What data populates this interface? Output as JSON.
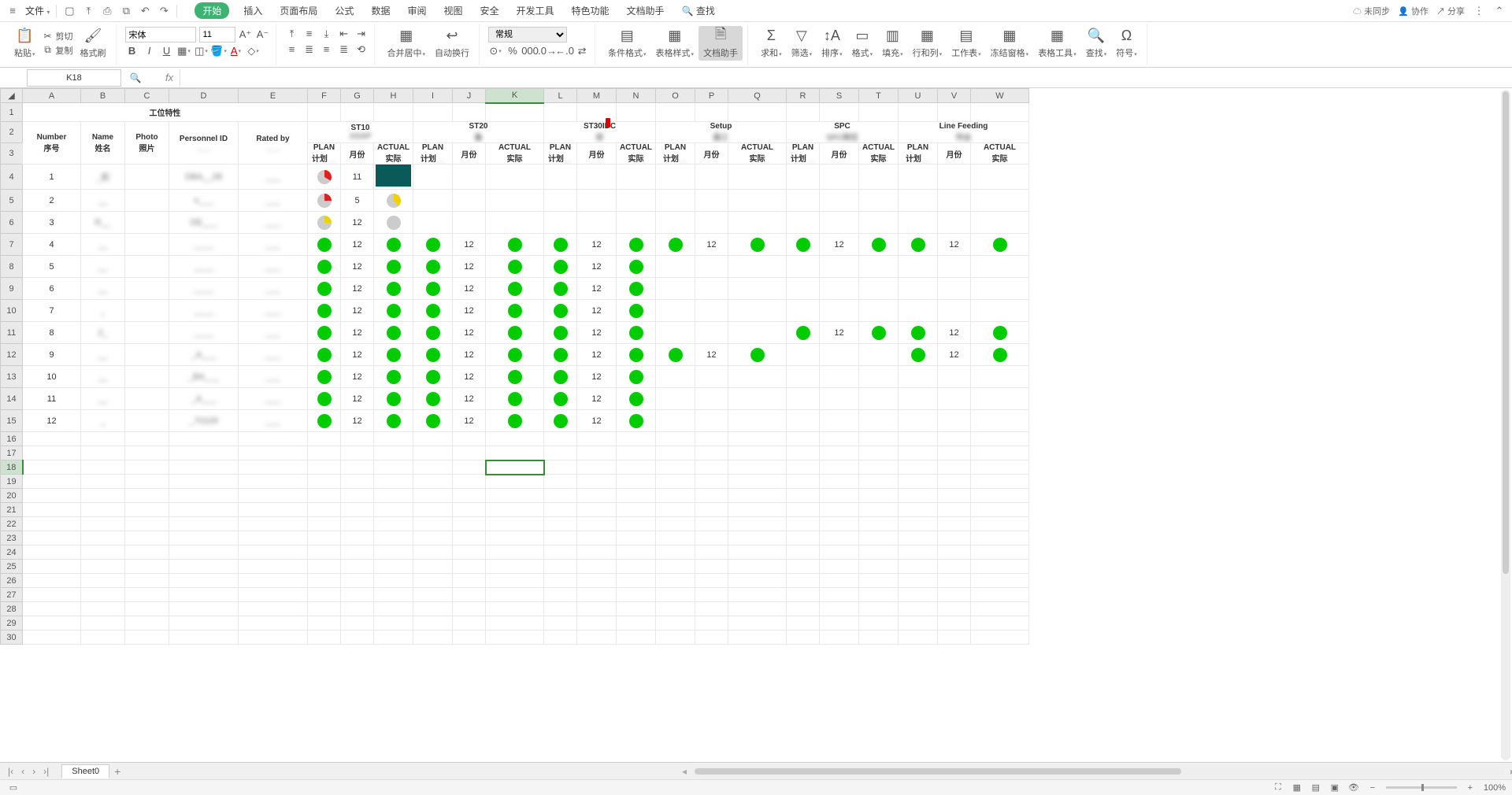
{
  "topbar": {
    "file": "文件",
    "quick": [
      "new",
      "open",
      "print",
      "print-preview",
      "undo",
      "redo"
    ],
    "menus": [
      "开始",
      "插入",
      "页面布局",
      "公式",
      "数据",
      "审阅",
      "视图",
      "安全",
      "开发工具",
      "特色功能",
      "文档助手"
    ],
    "active_menu": 0,
    "find": "查找",
    "right": {
      "sync": "未同步",
      "collab": "协作",
      "share": "分享"
    }
  },
  "ribbon": {
    "paste": "粘贴",
    "cut": "剪切",
    "copy": "复制",
    "format_painter": "格式刷",
    "font_name": "宋体",
    "font_size": "11",
    "merge": "合并居中",
    "wrap": "自动换行",
    "number_format": "常规",
    "cond_fmt": "条件格式",
    "table_style": "表格样式",
    "doc_helper": "文档助手",
    "sum": "求和",
    "filter": "筛选",
    "sort": "排序",
    "format": "格式",
    "fill": "填充",
    "rowcol": "行和列",
    "worksheet": "工作表",
    "freeze": "冻结窗格",
    "table_tools": "表格工具",
    "find_btn": "查找",
    "symbol": "符号"
  },
  "fbar": {
    "cell_ref": "K18",
    "formula": ""
  },
  "columns": [
    "A",
    "B",
    "C",
    "D",
    "E",
    "F",
    "G",
    "H",
    "I",
    "J",
    "K",
    "L",
    "M",
    "N",
    "O",
    "P",
    "Q",
    "R",
    "S",
    "T",
    "U",
    "V",
    "W"
  ],
  "selected_col": "K",
  "selected_row": 18,
  "row_headers": [
    1,
    2,
    3,
    4,
    5,
    6,
    7,
    8,
    9,
    10,
    11,
    12,
    13,
    14,
    15,
    16,
    17,
    18,
    19,
    20,
    21,
    22,
    23,
    24,
    25,
    26,
    27,
    28,
    29,
    30
  ],
  "h1": {
    "title": "工位特性",
    "stations": [
      "ST10",
      "ST20",
      "ST30IDC",
      "Setup",
      "SPC",
      "Line Feeding"
    ],
    "sub": [
      "ASAP",
      "备",
      "安",
      "装工",
      "SPC岗位",
      "作业"
    ]
  },
  "h2": {
    "number": "Number",
    "number2": "序号",
    "name": "Name",
    "name2": "姓名",
    "photo": "Photo",
    "photo2": "照片",
    "pid": "Personnel ID",
    "rated": "Rated by",
    "plan": "PLAN",
    "plan2": "计划",
    "month": "月份",
    "actual": "ACTUAL",
    "actual2": "实际"
  },
  "rows": [
    {
      "n": "1",
      "name": "_莉",
      "pid": "DBA__08",
      "rated": "___",
      "plan1": "pie-red33",
      "m1": "11",
      "a1": "teal"
    },
    {
      "n": "2",
      "name": "__",
      "pid": "n___",
      "rated": "___",
      "plan1": "pie-red25",
      "m1": "5",
      "a1": "pie-yel"
    },
    {
      "n": "3",
      "name": "R__",
      "pid": "DE___",
      "rated": "___",
      "plan1": "pie-yel25",
      "m1": "12",
      "a1": "pie-gry"
    },
    {
      "n": "4",
      "name": "__",
      "pid": "____",
      "rated": "___",
      "plan1": "green",
      "m1": "12",
      "a1": "green",
      "p2": "green",
      "m2": "12",
      "a2": "green",
      "p25": "green",
      "p3": "green",
      "m3": "12",
      "a3": "green",
      "p35": "green",
      "p4": "green",
      "m4": "12",
      "a4": "green",
      "p45": "green",
      "p5": "green",
      "m5": "12",
      "a5": "green",
      "p55": "green",
      "p6": "green",
      "m6": "12",
      "a6": "green"
    },
    {
      "n": "5",
      "name": "__",
      "pid": "____",
      "rated": "___",
      "plan1": "green",
      "m1": "12",
      "a1": "green",
      "p2": "green",
      "m2": "12",
      "a2": "green",
      "p25": "green",
      "p3": "green",
      "m3": "12",
      "a3": "green"
    },
    {
      "n": "6",
      "name": "__",
      "pid": "____",
      "rated": "___",
      "plan1": "green",
      "m1": "12",
      "a1": "green",
      "p2": "green",
      "m2": "12",
      "a2": "green",
      "p25": "green",
      "p3": "green",
      "m3": "12",
      "a3": "green"
    },
    {
      "n": "7",
      "name": "_",
      "pid": "____",
      "rated": "___",
      "plan1": "green",
      "m1": "12",
      "a1": "green",
      "p2": "green",
      "m2": "12",
      "a2": "green",
      "p25": "green",
      "p3": "green",
      "m3": "12",
      "a3": "green"
    },
    {
      "n": "8",
      "name": "2_",
      "pid": "____",
      "rated": "___",
      "plan1": "green",
      "m1": "12",
      "a1": "green",
      "p2": "green",
      "m2": "12",
      "a2": "green",
      "p25": "green",
      "p3": "green",
      "m3": "12",
      "a3": "green",
      "p45": "green",
      "p5": "green",
      "m5": "12",
      "a5": "green",
      "p55": "green",
      "p6": "green",
      "m6": "12",
      "a6": "green"
    },
    {
      "n": "9",
      "name": "__",
      "pid": "_A___",
      "rated": "___",
      "plan1": "green",
      "m1": "12",
      "a1": "green",
      "p2": "green",
      "m2": "12",
      "a2": "green",
      "p25": "green",
      "p3": "green",
      "m3": "12",
      "a3": "green",
      "p35": "green",
      "p4": "green",
      "m4": "12",
      "a4": "green",
      "p55": "green",
      "p6": "green",
      "m6": "12",
      "a6": "green"
    },
    {
      "n": "10",
      "name": "__",
      "pid": "_BA___",
      "rated": "___",
      "plan1": "green",
      "m1": "12",
      "a1": "green",
      "p2": "green",
      "m2": "12",
      "a2": "green",
      "p25": "green",
      "p3": "green",
      "m3": "12",
      "a3": "green"
    },
    {
      "n": "11",
      "name": "__",
      "pid": "_A___",
      "rated": "___",
      "plan1": "green",
      "m1": "12",
      "a1": "green",
      "p2": "green",
      "m2": "12",
      "a2": "green",
      "p25": "green",
      "p3": "green",
      "m3": "12",
      "a3": "green"
    },
    {
      "n": "12",
      "name": "_",
      "pid": "_70109",
      "rated": "___",
      "plan1": "green",
      "m1": "12",
      "a1": "green",
      "p2": "green",
      "m2": "12",
      "a2": "green",
      "p25": "green",
      "p3": "green",
      "m3": "12",
      "a3": "green"
    }
  ],
  "tabs": {
    "sheet": "Sheet0"
  },
  "status": {
    "zoom": "100%"
  }
}
